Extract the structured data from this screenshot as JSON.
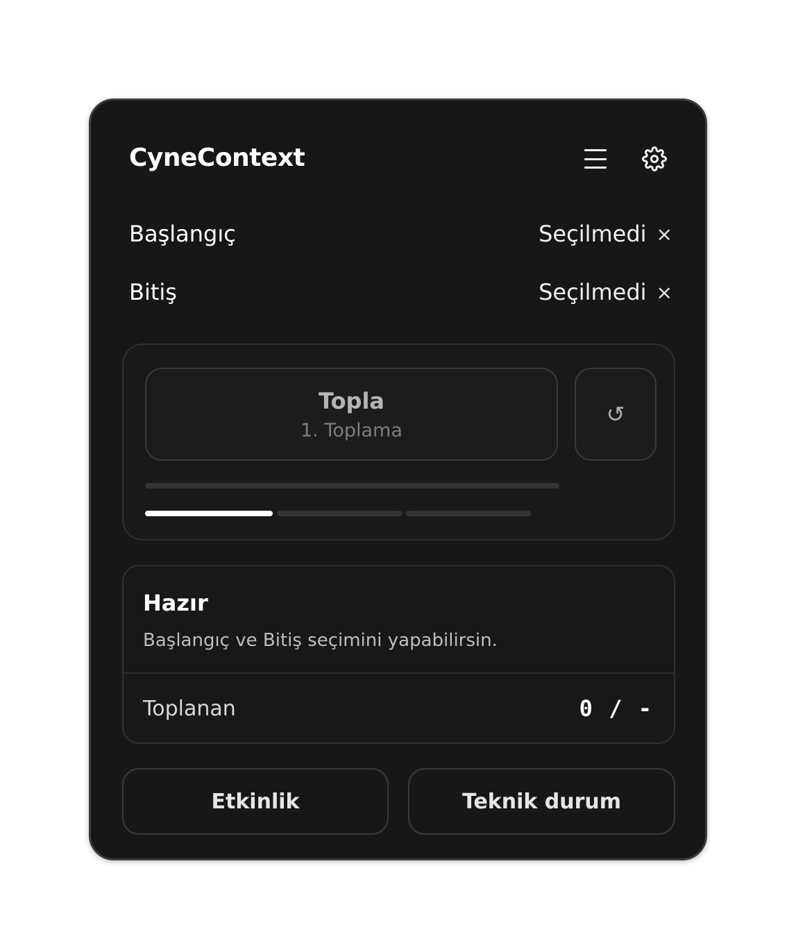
{
  "header": {
    "title": "CyneContext",
    "menu_icon": "hamburger-menu-icon",
    "settings_icon": "gear-icon"
  },
  "selection": {
    "start": {
      "label": "Başlangıç",
      "value": "Seçilmedi",
      "clear": "×"
    },
    "end": {
      "label": "Bitiş",
      "value": "Seçilmedi",
      "clear": "×"
    }
  },
  "collect": {
    "button_title": "Topla",
    "button_subtitle": "1. Toplama",
    "reset_icon": "↺",
    "progress": 1.0,
    "steps_total": 3,
    "step_active": 1
  },
  "status": {
    "title": "Hazır",
    "description": "Başlangıç ve Bitiş seçimini yapabilirsin.",
    "count_label": "Toplanan",
    "count_value": "0 / -"
  },
  "actions": {
    "activity_label": "Etkinlik",
    "technical_label": "Teknik durum"
  },
  "colors": {
    "panel_bg": "#171717",
    "border": "#3a3a3a",
    "accent": "#ffffff",
    "muted_text": "#7d7d7d"
  }
}
